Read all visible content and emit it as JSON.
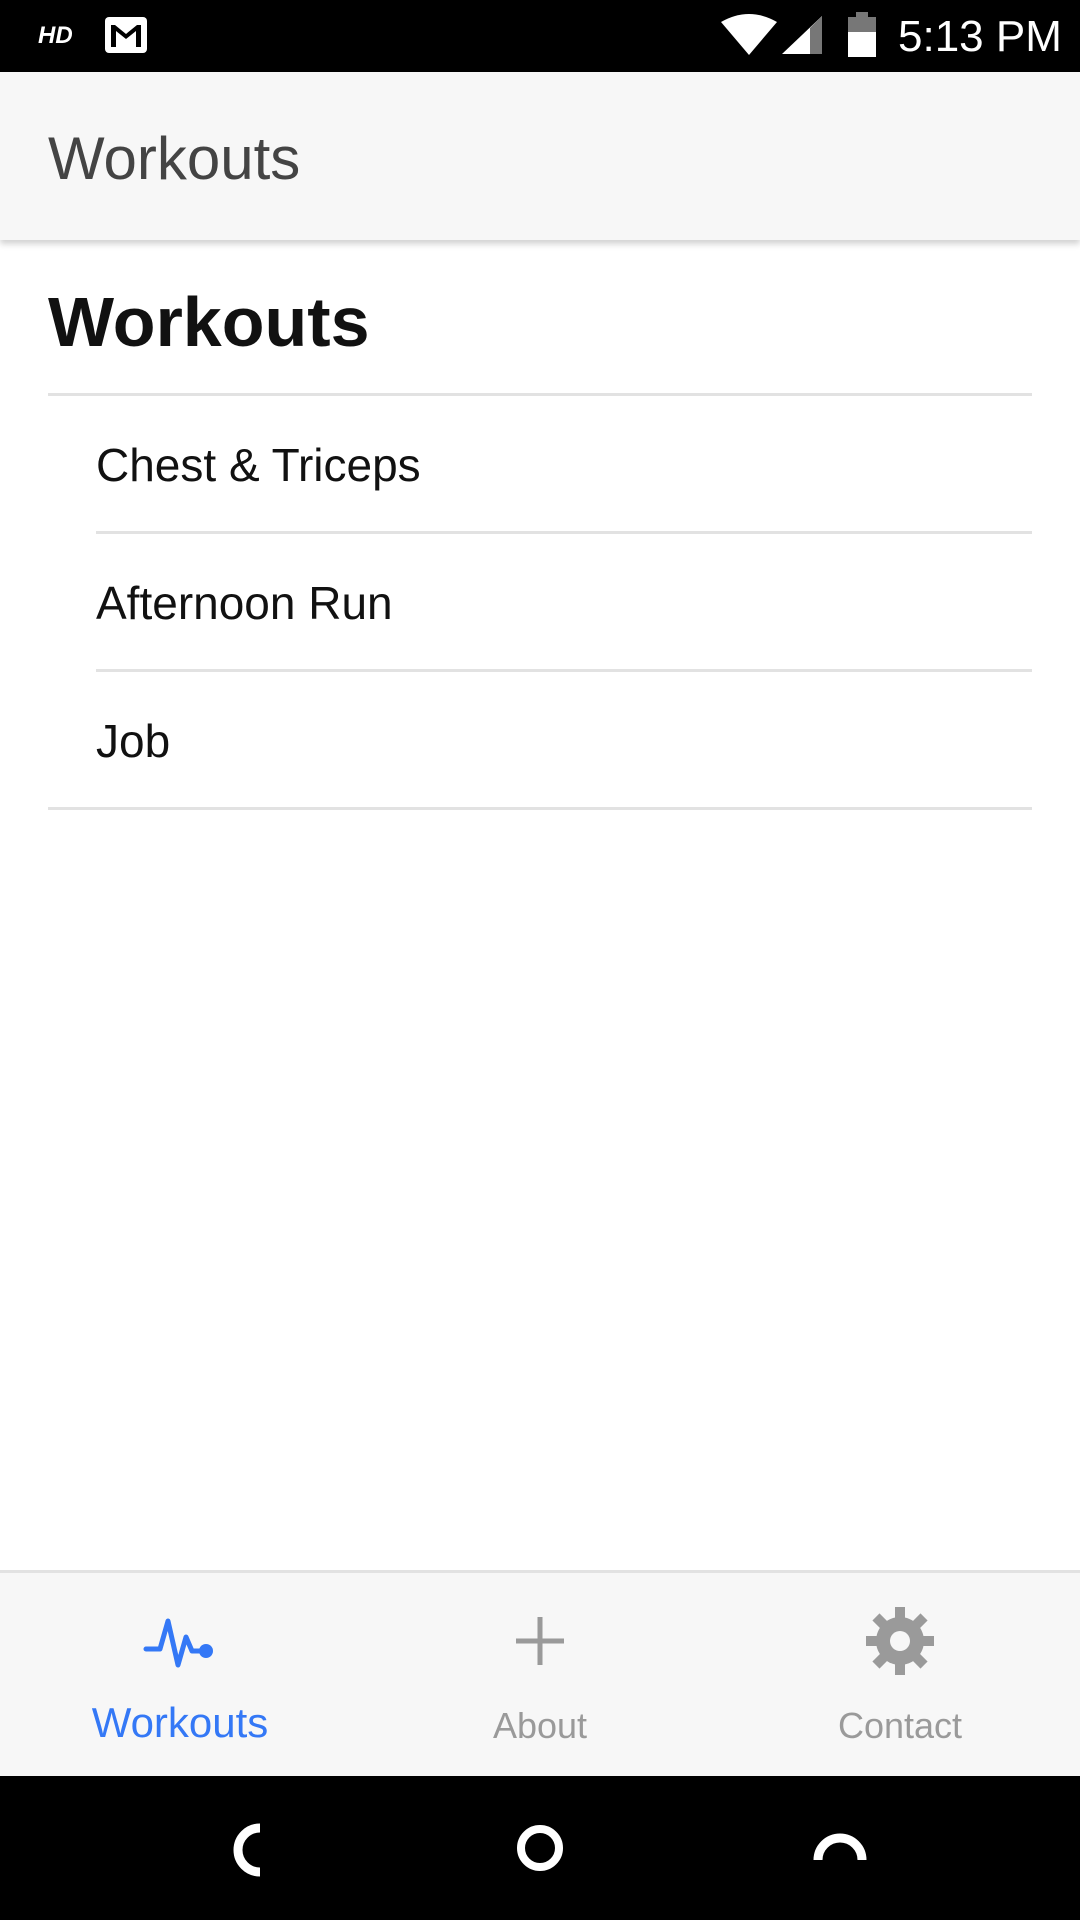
{
  "status_bar": {
    "hd_label": "HD",
    "time": "5:13 PM",
    "icons": [
      "hd-icon",
      "gmail-icon",
      "wifi-icon",
      "signal-icon",
      "battery-icon"
    ]
  },
  "header": {
    "title": "Workouts"
  },
  "main": {
    "section_title": "Workouts",
    "items": [
      {
        "label": "Chest & Triceps"
      },
      {
        "label": "Afternoon Run"
      },
      {
        "label": "Job"
      }
    ]
  },
  "tabs": [
    {
      "label": "Workouts",
      "icon": "pulse-icon",
      "active": true
    },
    {
      "label": "About",
      "icon": "plus-icon",
      "active": false
    },
    {
      "label": "Contact",
      "icon": "gear-icon",
      "active": false
    }
  ],
  "colors": {
    "accent": "#3478f6",
    "inactive": "#9a9a9a",
    "header_bg": "#f7f7f7"
  },
  "nav_bar": {
    "icons": [
      "back-icon",
      "home-icon",
      "recents-icon"
    ]
  }
}
